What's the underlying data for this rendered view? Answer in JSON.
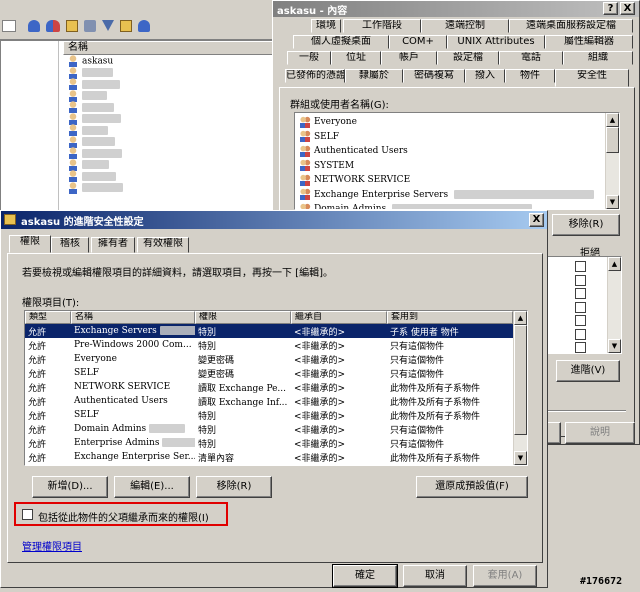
{
  "background": {
    "list_header": "名稱",
    "users": [
      "askasu",
      "",
      "",
      "",
      "",
      "",
      "",
      "",
      "",
      "",
      "",
      ""
    ]
  },
  "props": {
    "title": "askasu - 內容",
    "title_buttons": [
      "?",
      "X"
    ],
    "tabs_row1": [
      "環境",
      "工作階段",
      "遠端控制",
      "遠端桌面服務設定檔"
    ],
    "tabs_row2": [
      "個人虛擬桌面",
      "COM+",
      "UNIX Attributes",
      "屬性編輯器"
    ],
    "tabs_row3": [
      "一般",
      "位址",
      "帳戶",
      "設定檔",
      "電話",
      "組織"
    ],
    "tabs_row4": [
      "已發佈的憑證",
      "隸屬於",
      "密碼複寫",
      "撥入",
      "物件",
      "安全性"
    ],
    "groups_label": "群組或使用者名稱(G):",
    "principals": [
      {
        "name": "Everyone",
        "icon": "group-icon"
      },
      {
        "name": "SELF",
        "icon": "group-icon"
      },
      {
        "name": "Authenticated Users",
        "icon": "group-icon"
      },
      {
        "name": "SYSTEM",
        "icon": "group-icon"
      },
      {
        "name": "NETWORK SERVICE",
        "icon": "group-icon"
      },
      {
        "name": "Exchange Enterprise Servers",
        "icon": "group-icon"
      },
      {
        "name": "Domain Admins",
        "icon": "group-icon"
      }
    ],
    "remove_button": "移除(R)",
    "deny_header": "拒絕",
    "advanced_button": "進階(V)",
    "help_button": "說明"
  },
  "adv": {
    "title": "askasu 的進階安全性設定",
    "tabs": [
      "權限",
      "稽核",
      "擁有者",
      "有效權限"
    ],
    "instruction": "若要檢視或編輯權限項目的詳細資料，請選取項目，再按一下 [編輯]。",
    "entries_label": "權限項目(T):",
    "columns": [
      "類型",
      "名稱",
      "權限",
      "繼承自",
      "套用到"
    ],
    "rows": [
      [
        "允許",
        "Exchange Servers",
        "特別",
        "<非繼承的>",
        "子系 使用者 物件"
      ],
      [
        "允許",
        "Pre-Windows 2000 Com...",
        "特別",
        "<非繼承的>",
        "只有這個物件"
      ],
      [
        "允許",
        "Everyone",
        "變更密碼",
        "<非繼承的>",
        "只有這個物件"
      ],
      [
        "允許",
        "SELF",
        "變更密碼",
        "<非繼承的>",
        "只有這個物件"
      ],
      [
        "允許",
        "NETWORK SERVICE",
        "讀取 Exchange Pe...",
        "<非繼承的>",
        "此物件及所有子系物件"
      ],
      [
        "允許",
        "Authenticated Users",
        "讀取 Exchange Inf...",
        "<非繼承的>",
        "此物件及所有子系物件"
      ],
      [
        "允許",
        "SELF",
        "特別",
        "<非繼承的>",
        "此物件及所有子系物件"
      ],
      [
        "允許",
        "Domain Admins",
        "特別",
        "<非繼承的>",
        "只有這個物件"
      ],
      [
        "允許",
        "Enterprise Admins",
        "特別",
        "<非繼承的>",
        "只有這個物件"
      ],
      [
        "允許",
        "Exchange Enterprise Ser...",
        "清單內容",
        "<非繼承的>",
        "此物件及所有子系物件"
      ]
    ],
    "add_button": "新增(D)...",
    "edit_button": "編輯(E)...",
    "remove_button": "移除(R)",
    "restore_button": "還原成預設值(F)",
    "inherit_checkbox": "包括從此物件的父項繼承而來的權限(I)",
    "manage_link": "管理權限項目",
    "ok_button": "確定",
    "cancel_button": "取消",
    "apply_button": "套用(A)",
    "close_button": "X"
  },
  "watermark": "#176672",
  "colors": {
    "titlebar": "#0a246a",
    "highlight_box": "#e00000",
    "link": "#0000cc"
  }
}
